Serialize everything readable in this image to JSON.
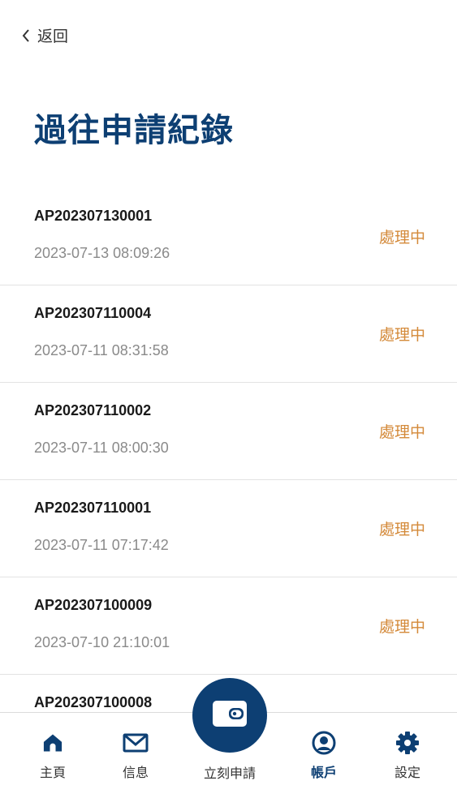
{
  "header": {
    "back_label": "返回",
    "title": "過往申請紀錄"
  },
  "records": [
    {
      "id": "AP202307130001",
      "time": "2023-07-13 08:09:26",
      "status": "處理中"
    },
    {
      "id": "AP202307110004",
      "time": "2023-07-11 08:31:58",
      "status": "處理中"
    },
    {
      "id": "AP202307110002",
      "time": "2023-07-11 08:00:30",
      "status": "處理中"
    },
    {
      "id": "AP202307110001",
      "time": "2023-07-11 07:17:42",
      "status": "處理中"
    },
    {
      "id": "AP202307100009",
      "time": "2023-07-10 21:10:01",
      "status": "處理中"
    },
    {
      "id": "AP202307100008",
      "time": "",
      "status": ""
    }
  ],
  "tabbar": {
    "home_label": "主頁",
    "messages_label": "信息",
    "apply_label": "立刻申請",
    "account_label": "帳戶",
    "settings_label": "設定"
  },
  "colors": {
    "primary": "#0d3f73",
    "status": "#d48a3a",
    "muted_text": "#8a8a8a"
  },
  "icons": {
    "back": "chevron-left-icon",
    "home": "home-icon",
    "messages": "envelope-icon",
    "apply": "wallet-icon",
    "account": "user-circle-icon",
    "settings": "gear-icon"
  }
}
